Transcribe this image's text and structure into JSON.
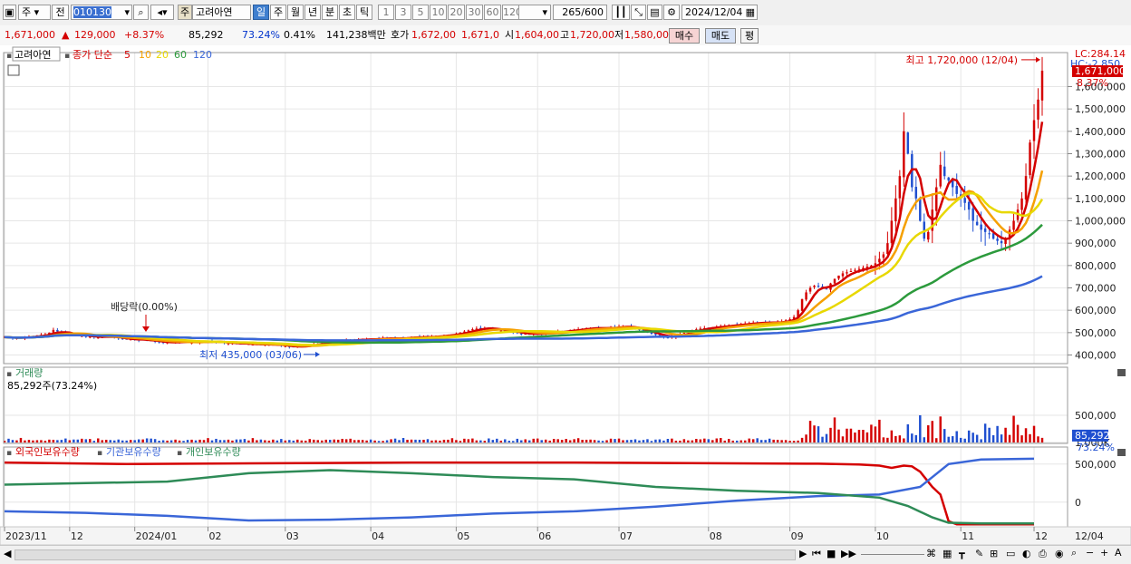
{
  "toolbar": {
    "market": "주",
    "prefix": "전",
    "code": "010130",
    "name_tag": "주",
    "stock_name": "고려아연",
    "periods": [
      "일",
      "주",
      "월",
      "년",
      "분",
      "초",
      "틱"
    ],
    "active_period": "일",
    "intervals": [
      "1",
      "3",
      "5",
      "10",
      "20",
      "30",
      "60",
      "120"
    ],
    "count": "265",
    "count_total": "/600",
    "date": "2024/12/04"
  },
  "quote": {
    "price": "1,671,000",
    "change_arrow": "▲",
    "change": "129,000",
    "change_pct": "+8.37%",
    "volume": "85,292",
    "volume_ratio": "73.24%",
    "turnover": "0.41%",
    "amount": "141,238백만",
    "hoga_label": "호가",
    "ask": "1,672,00",
    "bid": "1,671,0",
    "open_label": "시",
    "open": "1,604,00",
    "high_label": "고",
    "high": "1,720,00",
    "low_label": "저",
    "low": "1,580,00",
    "buy_button": "매수",
    "sell_button": "매도",
    "avg_button": "평"
  },
  "price_panel": {
    "legend_name": "고려아연",
    "legend_ma_label": "종가 단순",
    "ma_periods": [
      {
        "label": "5",
        "color": "#d40000"
      },
      {
        "label": "10",
        "color": "#f5a000"
      },
      {
        "label": "20",
        "color": "#e8d800"
      },
      {
        "label": "60",
        "color": "#2c9a3c"
      },
      {
        "label": "120",
        "color": "#3a66d8"
      }
    ],
    "lc": "LC:284.14",
    "hc": "HC:-2.850",
    "current_price_tag": "1,671,000",
    "current_pct_tag": "8.37%",
    "max_label": "최고 1,720,000 (12/04)",
    "min_label": "최저 435,000 (03/06)",
    "dividend_label": "배당락(0.00%)",
    "y_ticks": [
      "1,600,000",
      "1,500,000",
      "1,400,000",
      "1,300,000",
      "1,200,000",
      "1,100,000",
      "1,000,000",
      "900,000",
      "800,000",
      "700,000",
      "600,000",
      "500,000",
      "400,000"
    ]
  },
  "volume_panel": {
    "title": "거래량",
    "value_text": "85,292주(73.24%)",
    "y_ticks": [
      "1,000K",
      "500,000"
    ],
    "tag_value": "85,292",
    "tag_pct": "73.24%"
  },
  "holding_panel": {
    "legends": [
      "외국인보유수량",
      "기관보유수량",
      "개인보유수량"
    ],
    "y_ticks": [
      "500,000",
      "0"
    ]
  },
  "x_axis": {
    "labels": [
      "2023/11",
      "12",
      "2024/01",
      "02",
      "03",
      "04",
      "05",
      "06",
      "07",
      "08",
      "09",
      "10",
      "11",
      "12"
    ],
    "end_label": "12/04"
  },
  "colors": {
    "up": "#d40000",
    "down": "#1f4fd0",
    "ma5": "#d40000",
    "ma10": "#f5a000",
    "ma20": "#e8d800",
    "ma60": "#2c9a3c",
    "ma120": "#3a66d8",
    "foreign": "#d40000",
    "institution": "#3a66d8",
    "individual": "#2e8b57"
  },
  "chart_data": {
    "type": "line",
    "x_months": [
      "2023/11",
      "12",
      "2024/01",
      "02",
      "03",
      "04",
      "05",
      "06",
      "07",
      "08",
      "09",
      "10",
      "11",
      "12"
    ],
    "x_index": [
      0,
      16,
      32,
      50,
      69,
      90,
      111,
      131,
      151,
      173,
      193,
      214,
      235,
      253
    ],
    "close": [
      480000,
      478000,
      475000,
      476000,
      478000,
      480000,
      482000,
      484000,
      486000,
      490000,
      492000,
      500000,
      512000,
      505000,
      498000,
      492000,
      495000,
      490000,
      487000,
      485000,
      484000,
      482000,
      480000,
      478000,
      482000,
      485000,
      482000,
      478000,
      474000,
      470000,
      472000,
      470000,
      468000,
      466000,
      470000,
      467000,
      462000,
      460000,
      458000,
      455000,
      456000,
      457000,
      458000,
      460000,
      458000,
      457000,
      455000,
      457000,
      458000,
      460000,
      462000,
      460000,
      458000,
      456000,
      454000,
      452000,
      453000,
      452000,
      450000,
      451000,
      449000,
      447000,
      448000,
      446000,
      447000,
      448000,
      446000,
      444000,
      442000,
      440000,
      437000,
      435000,
      438000,
      440000,
      442000,
      445000,
      448000,
      450000,
      452000,
      455000,
      456000,
      458000,
      460000,
      462000,
      465000,
      467000,
      468000,
      470000,
      470000,
      468000,
      470000,
      472000,
      474000,
      475000,
      474000,
      473000,
      474000,
      475000,
      476000,
      478000,
      480000,
      480000,
      479000,
      480000,
      481000,
      482000,
      484000,
      486000,
      488000,
      490000,
      492000,
      496000,
      500000,
      505000,
      510000,
      515000,
      518000,
      520000,
      520000,
      518000,
      515000,
      512000,
      510000,
      508000,
      505000,
      500000,
      498000,
      496000,
      495000,
      494000,
      495000,
      496000,
      497000,
      498000,
      500000,
      502000,
      505000,
      507000,
      508000,
      510000,
      512000,
      515000,
      518000,
      520000,
      521000,
      522000,
      520000,
      518000,
      520000,
      522000,
      525000,
      527000,
      528000,
      526000,
      522000,
      518000,
      512000,
      505000,
      500000,
      495000,
      490000,
      485000,
      480000,
      478000,
      482000,
      488000,
      495000,
      500000,
      505000,
      510000,
      515000,
      518000,
      520000,
      522000,
      524000,
      526000,
      528000,
      530000,
      532000,
      534000,
      536000,
      538000,
      540000,
      542000,
      543000,
      544000,
      545000,
      545000,
      544000,
      545000,
      546000,
      550000,
      555000,
      560000,
      570000,
      600000,
      650000,
      680000,
      700000,
      710000,
      705000,
      700000,
      695000,
      720000,
      740000,
      755000,
      765000,
      770000,
      775000,
      780000,
      785000,
      790000,
      795000,
      800000,
      810000,
      830000,
      850000,
      900000,
      1000000,
      1100000,
      1200000,
      1400000,
      1300000,
      1150000,
      1100000,
      1000000,
      920000,
      950000,
      1050000,
      1150000,
      1250000,
      1200000,
      1180000,
      1150000,
      1120000,
      1100000,
      1080000,
      1050000,
      1000000,
      980000,
      960000,
      950000,
      940000,
      920000,
      910000,
      900000,
      920000,
      960000,
      1000000,
      1050000,
      1100000,
      1200000,
      1350000,
      1450000,
      1542000,
      1671000
    ],
    "y_range": [
      400000,
      1720000
    ],
    "max": {
      "value": 1720000,
      "date": "12/04"
    },
    "min": {
      "value": 435000,
      "date": "03/06"
    },
    "ma_windows": [
      5,
      10,
      20,
      60,
      120
    ],
    "volume": {
      "ylim": [
        0,
        1200000
      ],
      "last": 85292
    },
    "holdings": {
      "ylim": [
        -300000,
        700000
      ],
      "foreign": [
        [
          0,
          520000
        ],
        [
          30,
          500000
        ],
        [
          60,
          510000
        ],
        [
          100,
          520000
        ],
        [
          140,
          520000
        ],
        [
          180,
          510000
        ],
        [
          200,
          505000
        ],
        [
          210,
          495000
        ],
        [
          215,
          480000
        ],
        [
          218,
          450000
        ],
        [
          221,
          480000
        ],
        [
          223,
          470000
        ],
        [
          225,
          400000
        ],
        [
          228,
          200000
        ],
        [
          230,
          100000
        ],
        [
          232,
          -250000
        ],
        [
          234,
          -290000
        ],
        [
          250,
          -290000
        ],
        [
          253,
          -290000
        ]
      ],
      "institution": [
        [
          0,
          -120000
        ],
        [
          20,
          -140000
        ],
        [
          40,
          -180000
        ],
        [
          60,
          -240000
        ],
        [
          80,
          -230000
        ],
        [
          100,
          -200000
        ],
        [
          120,
          -150000
        ],
        [
          140,
          -120000
        ],
        [
          160,
          -60000
        ],
        [
          180,
          20000
        ],
        [
          200,
          80000
        ],
        [
          215,
          100000
        ],
        [
          225,
          200000
        ],
        [
          232,
          500000
        ],
        [
          240,
          560000
        ],
        [
          253,
          570000
        ]
      ],
      "individual": [
        [
          0,
          230000
        ],
        [
          20,
          250000
        ],
        [
          40,
          270000
        ],
        [
          60,
          380000
        ],
        [
          80,
          420000
        ],
        [
          100,
          380000
        ],
        [
          120,
          330000
        ],
        [
          140,
          300000
        ],
        [
          160,
          200000
        ],
        [
          180,
          150000
        ],
        [
          200,
          120000
        ],
        [
          215,
          60000
        ],
        [
          222,
          -50000
        ],
        [
          228,
          -200000
        ],
        [
          232,
          -270000
        ],
        [
          240,
          -280000
        ],
        [
          253,
          -280000
        ]
      ]
    }
  }
}
